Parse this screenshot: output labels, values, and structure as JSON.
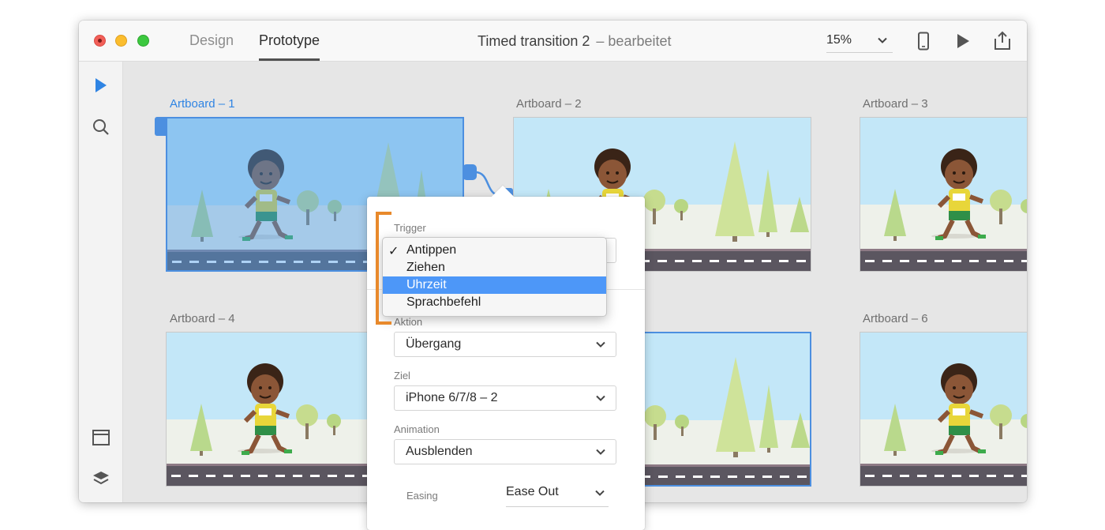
{
  "window": {
    "tabs": [
      {
        "label": "Design",
        "active": false
      },
      {
        "label": "Prototype",
        "active": true
      }
    ],
    "doc_title": "Timed transition 2",
    "doc_status": "– bearbeitet",
    "zoom": "15%"
  },
  "artboards": [
    {
      "label": "Artboard – 1",
      "selected": true
    },
    {
      "label": "Artboard – 2"
    },
    {
      "label": "Artboard – 3"
    },
    {
      "label": "Artboard – 4"
    },
    {
      "label": "Artboard – 6"
    }
  ],
  "popover": {
    "trigger_label": "Trigger",
    "action_label": "Aktion",
    "action_value": "Übergang",
    "target_label": "Ziel",
    "target_value": "iPhone 6/7/8 – 2",
    "animation_label": "Animation",
    "animation_value": "Ausblenden",
    "easing_label": "Easing",
    "easing_value": "Ease Out"
  },
  "trigger_menu": {
    "check_mark": "✓",
    "items": [
      {
        "label": "Antippen",
        "checked": true,
        "highlighted": false
      },
      {
        "label": "Ziehen",
        "checked": false,
        "highlighted": false
      },
      {
        "label": "Uhrzeit",
        "checked": false,
        "highlighted": true
      },
      {
        "label": "Sprachbefehl",
        "checked": false,
        "highlighted": false
      }
    ]
  },
  "colors": {
    "accent": "#2f84e3",
    "highlight": "#4d97f8",
    "annotation": "#e8892b",
    "road": "#5b5660",
    "sky": "#bfe5f7"
  },
  "icons": [
    "close-light",
    "minimize-light",
    "zoom-light",
    "chevron-down-icon",
    "phone-preview-icon",
    "play-icon",
    "share-icon",
    "select-arrow-icon",
    "search-icon",
    "artboard-icon",
    "layers-icon",
    "checkmark-icon"
  ]
}
